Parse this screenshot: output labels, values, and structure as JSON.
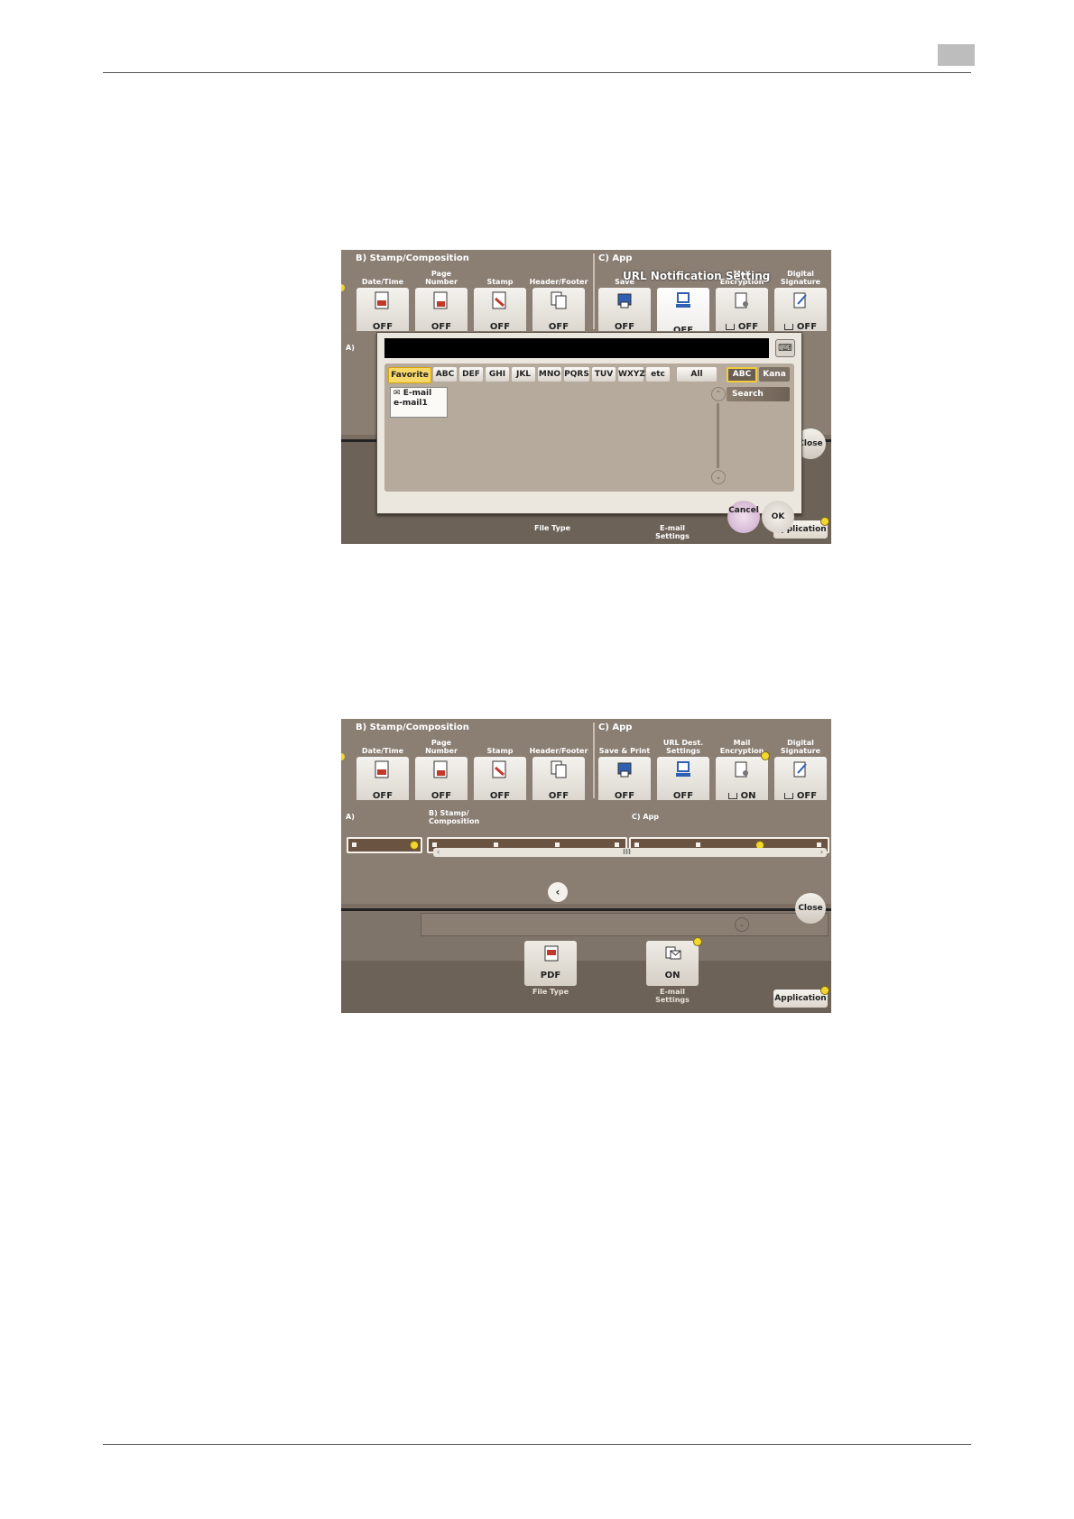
{
  "header": {
    "tab_label": ""
  },
  "screen1": {
    "group_b": "B)  Stamp/Composition",
    "group_c": "C)  App",
    "functions": [
      {
        "label": "Date/Time",
        "value": "OFF",
        "icon": "date-time-icon"
      },
      {
        "label": "Page Number",
        "value": "OFF",
        "icon": "page-number-icon"
      },
      {
        "label": "Stamp",
        "value": "OFF",
        "icon": "stamp-icon"
      },
      {
        "label": "Header/Footer",
        "value": "OFF",
        "icon": "header-footer-icon"
      },
      {
        "label": "Save",
        "value": "OFF",
        "icon": "save-print-icon"
      },
      {
        "label": "",
        "value": "OFF",
        "icon": "url-dest-icon"
      },
      {
        "label": "Mail Encryption",
        "value": "OFF",
        "icon": "mail-encryption-icon"
      },
      {
        "label": "Digital Signature",
        "value": "OFF",
        "icon": "digital-signature-icon"
      }
    ],
    "section_a": "A)",
    "close": "Close",
    "file_type_caption": "File Type",
    "email_caption": "E-mail Settings",
    "application": "Application",
    "dialog": {
      "title": "URL Notification Setting",
      "keyboard_icon": "keyboard-icon",
      "tabs": [
        "Favorite",
        "ABC",
        "DEF",
        "GHI",
        "JKL",
        "MNO",
        "PQRS",
        "TUV",
        "WXYZ",
        "etc",
        "All"
      ],
      "lang_tabs": [
        "ABC",
        "Kana"
      ],
      "search": "Search",
      "destination": {
        "type": "E-mail",
        "name": "e-mail1"
      },
      "cancel": "Cancel",
      "ok": "OK"
    }
  },
  "screen2": {
    "group_b": "B)  Stamp/Composition",
    "group_c": "C)  App",
    "functions": [
      {
        "label": "Date/Time",
        "value": "OFF"
      },
      {
        "label": "Page Number",
        "value": "OFF"
      },
      {
        "label": "Stamp",
        "value": "OFF"
      },
      {
        "label": "Header/Footer",
        "value": "OFF"
      },
      {
        "label": "Save & Print",
        "value": "OFF"
      },
      {
        "label": "URL Dest. Settings",
        "value": "OFF"
      },
      {
        "label": "Mail Encryption",
        "value": "ON"
      },
      {
        "label": "Digital Signature",
        "value": "OFF"
      }
    ],
    "slider_labels": {
      "a": "A)",
      "b": "B) Stamp/ Composition",
      "c": "C) App"
    },
    "scroll_mid": "III",
    "close": "Close",
    "file_type": {
      "value": "PDF",
      "caption": "File Type"
    },
    "email": {
      "value": "ON",
      "caption": "E-mail Settings"
    },
    "application": "Application"
  }
}
